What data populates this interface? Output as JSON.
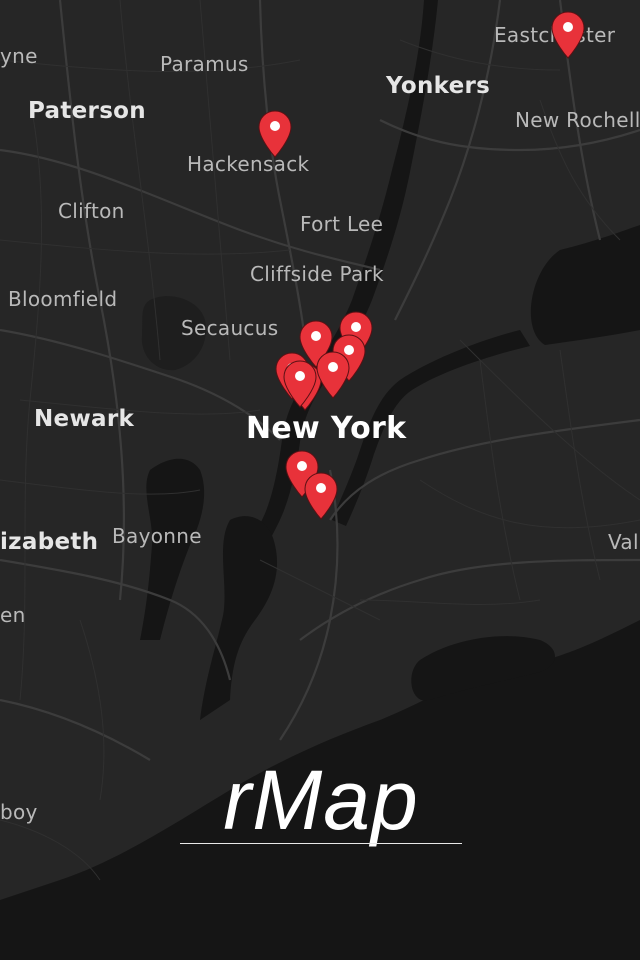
{
  "app": {
    "title": "rMap"
  },
  "map": {
    "colors": {
      "land": "#262626",
      "water": "#151515",
      "roads": "#3c3c3c",
      "marker": "#e8323a"
    },
    "places": [
      {
        "key": "wayne",
        "label": "yne"
      },
      {
        "key": "paramus",
        "label": "Paramus"
      },
      {
        "key": "paterson",
        "label": "Paterson"
      },
      {
        "key": "hackensack",
        "label": "Hackensack"
      },
      {
        "key": "yonkers",
        "label": "Yonkers"
      },
      {
        "key": "eastchester",
        "label": "Eastchester"
      },
      {
        "key": "new_rochelle",
        "label": "New Rochelle"
      },
      {
        "key": "clifton",
        "label": "Clifton"
      },
      {
        "key": "fort_lee",
        "label": "Fort Lee"
      },
      {
        "key": "cliffside_park",
        "label": "Cliffside Park"
      },
      {
        "key": "bloomfield",
        "label": "Bloomfield"
      },
      {
        "key": "secaucus",
        "label": "Secaucus"
      },
      {
        "key": "newark",
        "label": "Newark"
      },
      {
        "key": "new_york",
        "label": "New York"
      },
      {
        "key": "elizabeth",
        "label": "izabeth"
      },
      {
        "key": "bayonne",
        "label": "Bayonne"
      },
      {
        "key": "valley_stream",
        "label": "Val"
      },
      {
        "key": "linden",
        "label": "en"
      },
      {
        "key": "amboy",
        "label": "boy"
      }
    ],
    "markers": [
      {
        "name": "marker-eastchester",
        "icon": "map-pin-icon"
      },
      {
        "name": "marker-hackensack",
        "icon": "map-pin-icon"
      },
      {
        "name": "marker-midtown-1",
        "icon": "map-pin-icon"
      },
      {
        "name": "marker-midtown-2",
        "icon": "map-pin-icon"
      },
      {
        "name": "marker-midtown-3",
        "icon": "map-pin-icon"
      },
      {
        "name": "marker-midtown-4",
        "icon": "map-pin-icon"
      },
      {
        "name": "marker-midtown-5",
        "icon": "map-pin-icon"
      },
      {
        "name": "marker-midtown-6",
        "icon": "map-pin-icon"
      },
      {
        "name": "marker-midtown-7",
        "icon": "map-pin-icon"
      },
      {
        "name": "marker-downtown-1",
        "icon": "map-pin-icon"
      },
      {
        "name": "marker-downtown-2",
        "icon": "map-pin-icon"
      }
    ]
  }
}
